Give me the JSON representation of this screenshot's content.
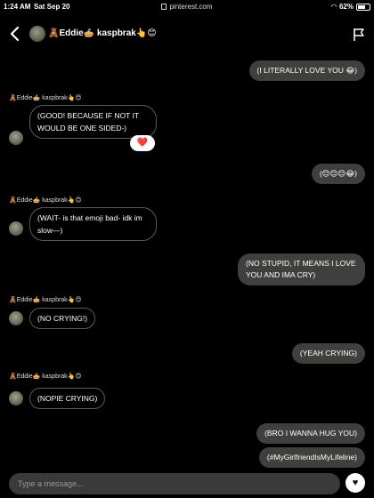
{
  "status_bar": {
    "time": "1:24 AM",
    "date": "Sat Sep 20",
    "url": "pinterest.com",
    "battery": "62%",
    "wifi_icon": "wifi-icon",
    "battery_icon": "battery-icon"
  },
  "header": {
    "contact_name": "🧸Eddie🥧 kaspbrak👆😊",
    "back_icon": "chevron-left-icon",
    "flag_icon": "flag-icon"
  },
  "messages": [
    {
      "direction": "out",
      "text": "(I LITERALLY LOVE YOU 😂)"
    },
    {
      "direction": "in",
      "sender": "🧸Eddie🥧 kaspbrak👆😊",
      "text": "(GOOD! BECAUSE IF NOT IT WOULD BE ONE SIDED-)",
      "reaction": "❤️"
    },
    {
      "direction": "out",
      "text": "(😊😊😊😂)"
    },
    {
      "direction": "in",
      "sender": "🧸Eddie🥧 kaspbrak👆😊",
      "text": "(WAIT- is that emoji bad- idk im slow—)"
    },
    {
      "direction": "out",
      "text": "(NO STUPID, IT MEANS I LOVE YOU AND IMA CRY)"
    },
    {
      "direction": "in",
      "sender": "🧸Eddie🥧 kaspbrak👆😊",
      "text": "(NO CRYING!)"
    },
    {
      "direction": "out",
      "text": "(YEAH CRYING)"
    },
    {
      "direction": "in",
      "sender": "🧸Eddie🥧 kaspbrak👆😊",
      "text": "(NOPIE CRYING)"
    },
    {
      "direction": "out",
      "text": "(BRO I WANNA HUG YOU)"
    },
    {
      "direction": "out",
      "text": "(#MyGirlfriendIsMyLifeline)"
    }
  ],
  "composer": {
    "placeholder": "Type a message...",
    "send_icon": "heart-icon",
    "send_glyph": "♥"
  },
  "colors": {
    "background": "#000000",
    "outgoing_bubble": "#3f3f3d",
    "incoming_border": "#5a5a5a",
    "reaction_heart": "#e0102a"
  }
}
